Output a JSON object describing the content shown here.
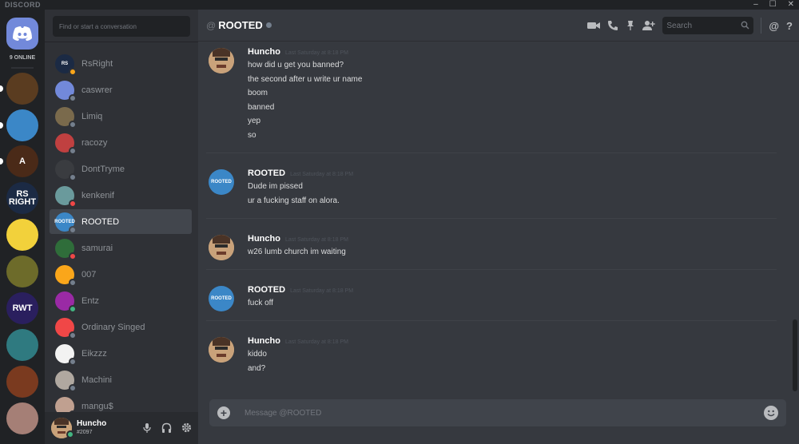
{
  "titlebar": {
    "app_name": "DISCORD",
    "minimize": "–",
    "maximize": "☐",
    "close": "✕"
  },
  "servers": {
    "online_count": "9 ONLINE",
    "list": [
      {
        "name": "rune-server",
        "color": "#5a3c20",
        "text": ""
      },
      {
        "name": "sky-server",
        "color": "#3b87c7",
        "text": ""
      },
      {
        "name": "a-server",
        "color": "#4a2a18",
        "text": "A"
      },
      {
        "name": "rsright-server",
        "color": "#1b2a44",
        "text": "RS RIGHT"
      },
      {
        "name": "pikachu-server",
        "color": "#f2d13b",
        "text": ""
      },
      {
        "name": "wreath-server",
        "color": "#6d6b2a",
        "text": ""
      },
      {
        "name": "rwt-server",
        "color": "#2a1f5e",
        "text": "RWT"
      },
      {
        "name": "teal-server",
        "color": "#2f7a80",
        "text": ""
      },
      {
        "name": "fire-server",
        "color": "#7a3a1f",
        "text": ""
      },
      {
        "name": "face-server",
        "color": "#a57f76",
        "text": ""
      }
    ]
  },
  "dms": {
    "search_placeholder": "Find or start a conversation",
    "items": [
      {
        "name": "RsRight",
        "color": "#1b2a44",
        "status": "#faa61a",
        "short": "RS"
      },
      {
        "name": "caswrer",
        "color": "#7289da",
        "status": "#747f8d",
        "short": ""
      },
      {
        "name": "Limiq",
        "color": "#7a6a4c",
        "status": "#747f8d",
        "short": ""
      },
      {
        "name": "racozy",
        "color": "#c04040",
        "status": "#747f8d",
        "short": ""
      },
      {
        "name": "DontTryme",
        "color": "#3a3c40",
        "status": "#747f8d",
        "short": ""
      },
      {
        "name": "kenkenif",
        "color": "#6a9a9c",
        "status": "#f04747",
        "short": ""
      },
      {
        "name": "ROOTED",
        "color": "#3b87c7",
        "status": "#747f8d",
        "short": "ROOTED"
      },
      {
        "name": "samurai",
        "color": "#2f6d3a",
        "status": "#f04747",
        "short": ""
      },
      {
        "name": "007",
        "color": "#faa61a",
        "status": "#747f8d",
        "short": ""
      },
      {
        "name": "Entz",
        "color": "#9a2aa5",
        "status": "#43b581",
        "short": ""
      },
      {
        "name": "Ordinary Singed",
        "color": "#f04747",
        "status": "#747f8d",
        "short": ""
      },
      {
        "name": "Eikzzz",
        "color": "#f2f2f2",
        "status": "#747f8d",
        "short": ""
      },
      {
        "name": "Machini",
        "color": "#b0a8a0",
        "status": "#747f8d",
        "short": ""
      },
      {
        "name": "mangu$",
        "color": "#c0a090",
        "status": "#747f8d",
        "short": ""
      }
    ]
  },
  "user": {
    "name": "Huncho",
    "tag": "#2097",
    "status_color": "#43b581"
  },
  "chat": {
    "at_symbol": "@",
    "title": "ROOTED",
    "search_placeholder": "Search",
    "mention_symbol": "@",
    "help_symbol": "?",
    "composer_placeholder": "Message @ROOTED",
    "messages": [
      {
        "author": "Huncho",
        "timestamp": "Last Saturday at 8:18 PM",
        "avatar_color": "#d2b48c",
        "avatar_text": "",
        "lines": [
          "how did u get you banned?",
          "the second after u write ur name",
          "boom",
          "banned",
          "yep",
          "so"
        ]
      },
      {
        "author": "ROOTED",
        "timestamp": "Last Saturday at 8:18 PM",
        "avatar_color": "#3b87c7",
        "avatar_text": "ROOTED",
        "lines": [
          "Dude im pissed",
          "ur a fucking staff on alora."
        ]
      },
      {
        "author": "Huncho",
        "timestamp": "Last Saturday at 8:18 PM",
        "avatar_color": "#d2b48c",
        "avatar_text": "",
        "lines": [
          "w26 lumb church im waiting"
        ]
      },
      {
        "author": "ROOTED",
        "timestamp": "Last Saturday at 8:18 PM",
        "avatar_color": "#3b87c7",
        "avatar_text": "ROOTED",
        "lines": [
          "fuck off"
        ]
      },
      {
        "author": "Huncho",
        "timestamp": "Last Saturday at 8:18 PM",
        "avatar_color": "#d2b48c",
        "avatar_text": "",
        "lines": [
          "kiddo",
          "and?"
        ]
      }
    ]
  }
}
